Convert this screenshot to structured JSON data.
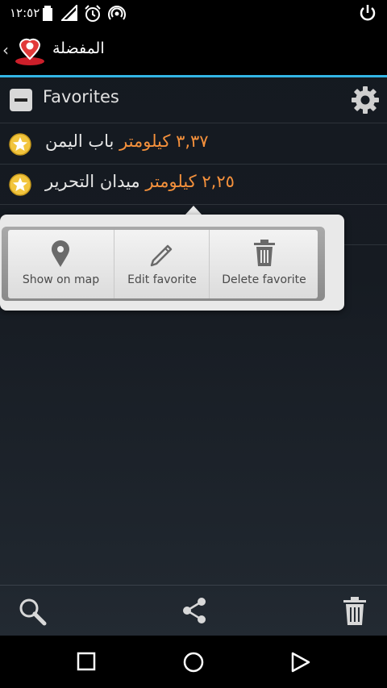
{
  "status_bar": {
    "time": "١٢:٥٢"
  },
  "header": {
    "title": "المفضلة"
  },
  "group": {
    "title": "Favorites"
  },
  "favorites": [
    {
      "name": "باب اليمن",
      "distance": "٣,٣٧ كيلومتر"
    },
    {
      "name": "ميدان التحرير",
      "distance": "٢,٢٥ كيلومتر"
    }
  ],
  "popup": {
    "actions": [
      {
        "label": "Show on map",
        "icon": "map-pin-icon"
      },
      {
        "label": "Edit favorite",
        "icon": "pencil-icon"
      },
      {
        "label": "Delete favorite",
        "icon": "trash-icon"
      }
    ]
  },
  "bottom_bar": {
    "icons": [
      "search-icon",
      "share-icon",
      "trash-icon"
    ]
  },
  "colors": {
    "accent": "#33b5e5",
    "distance": "#f5913c",
    "star": "#f2c53d"
  }
}
